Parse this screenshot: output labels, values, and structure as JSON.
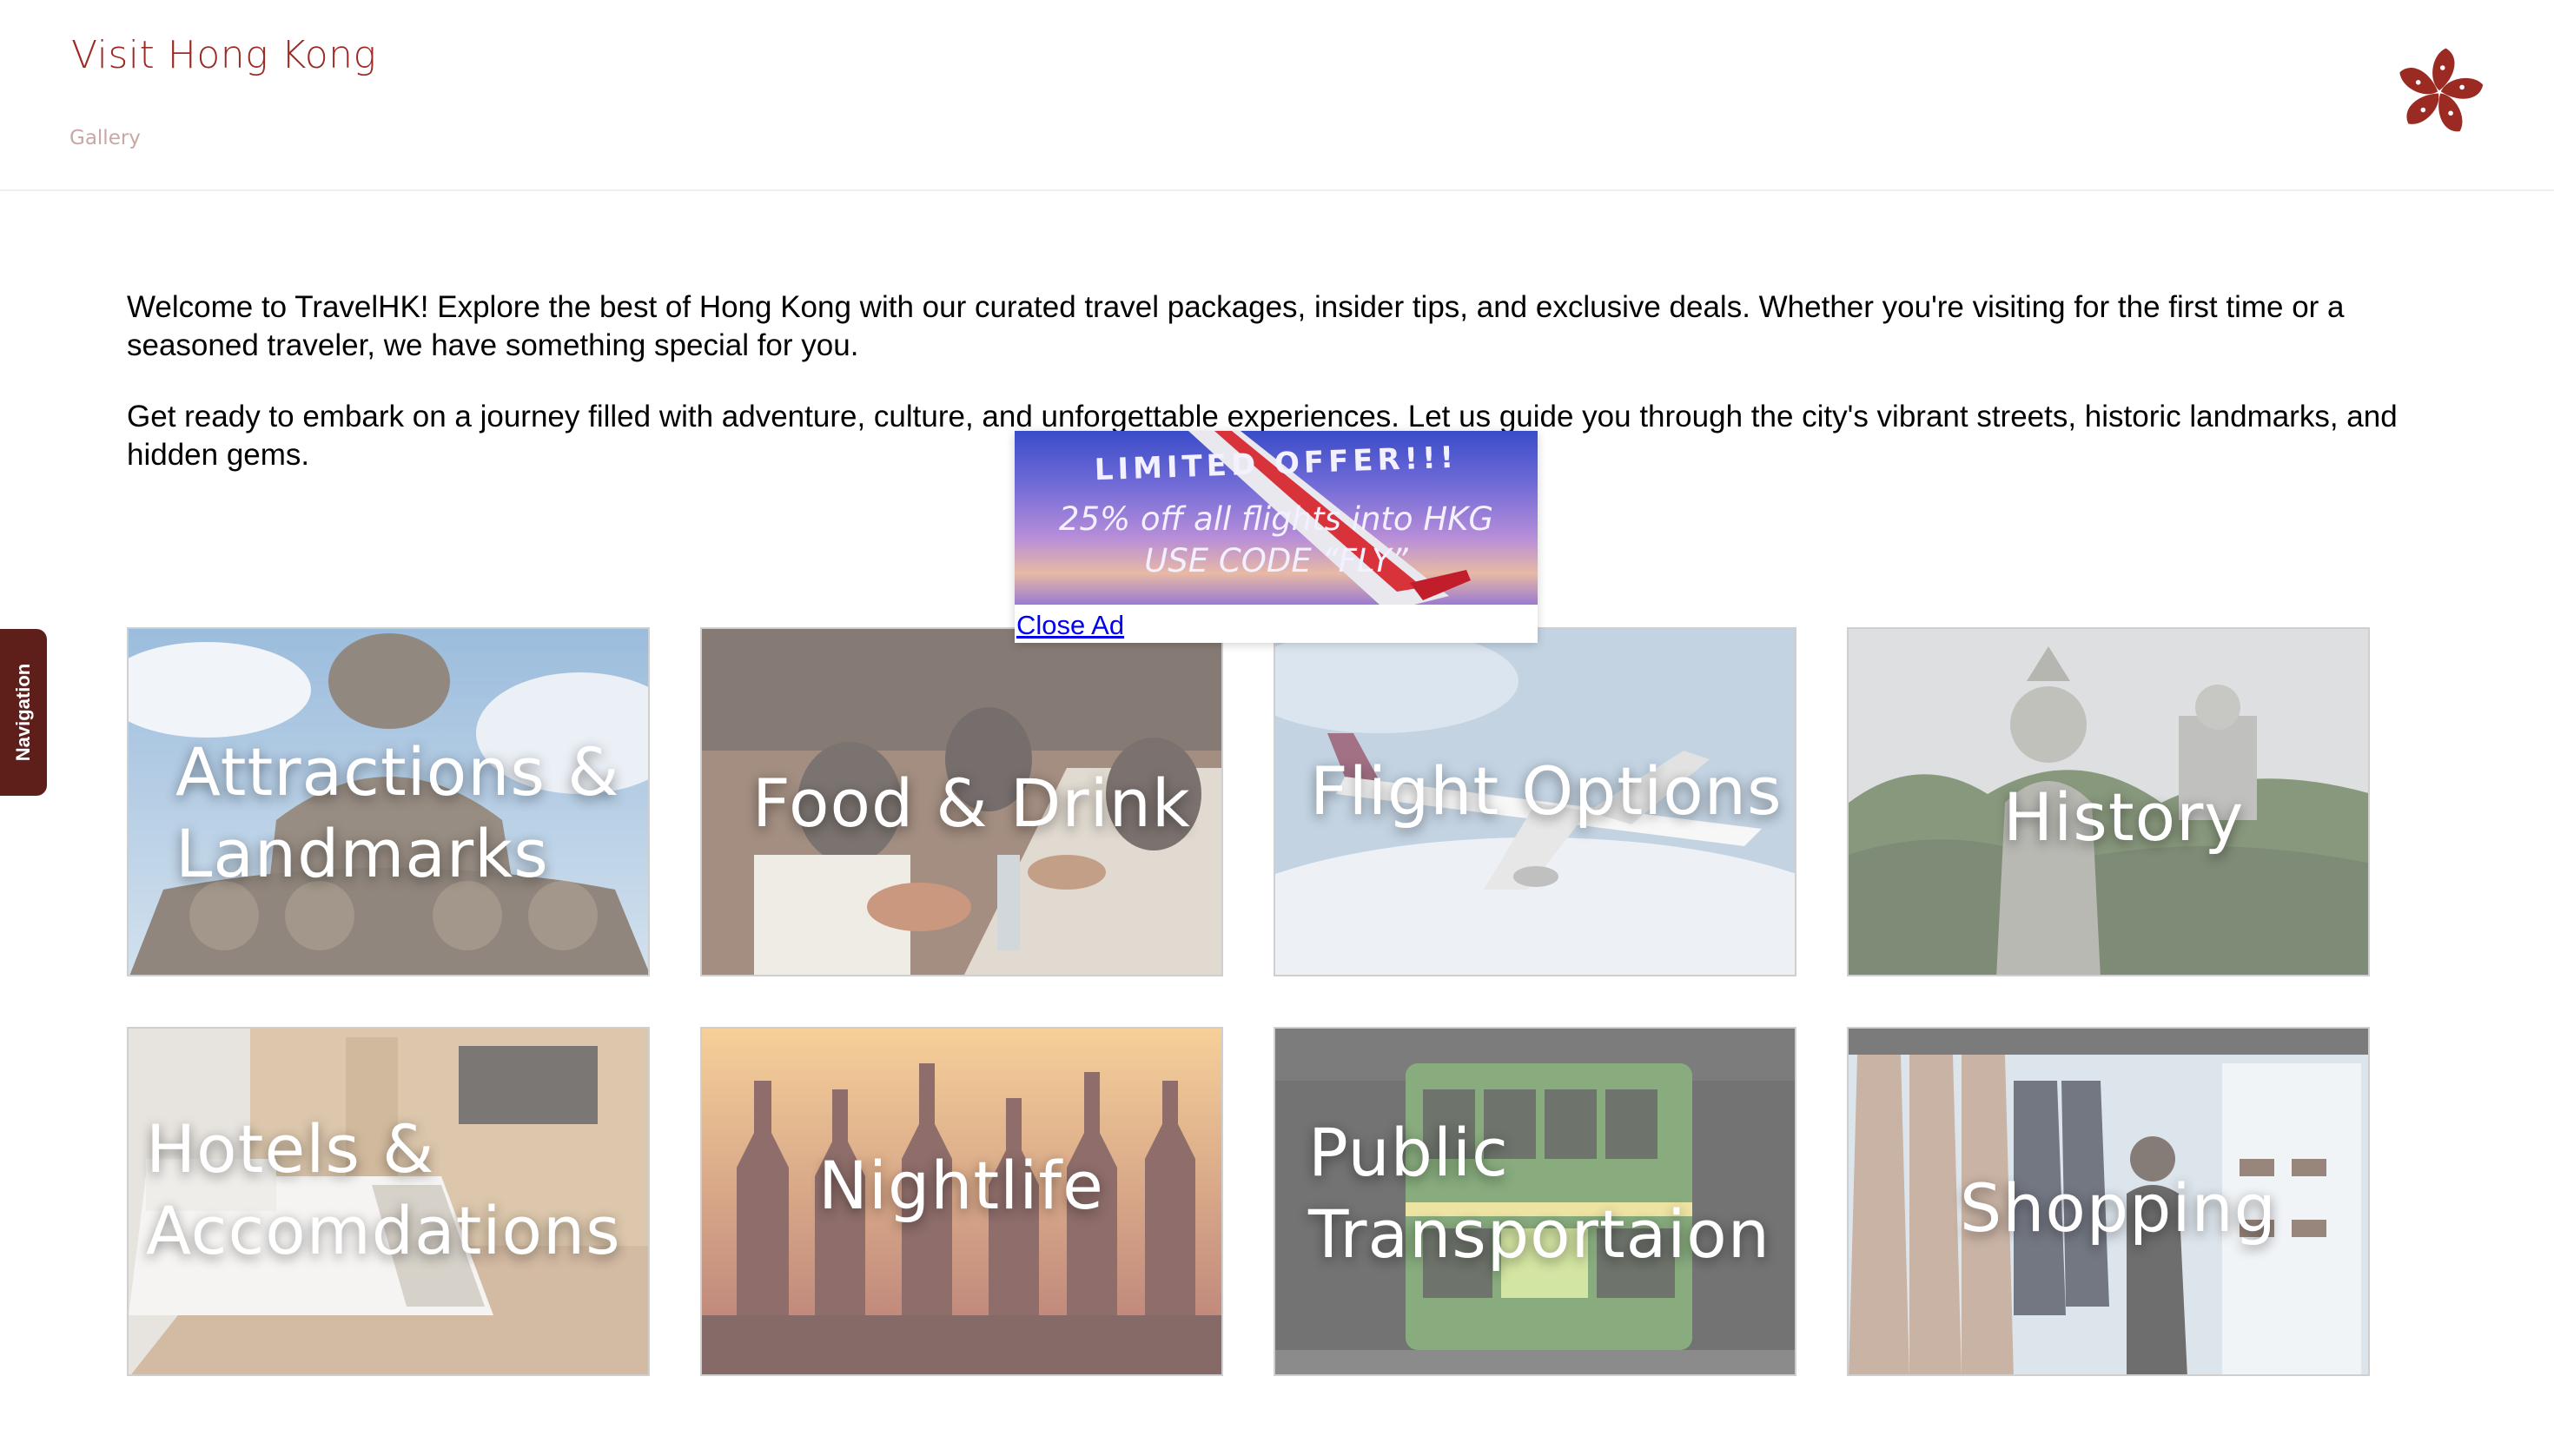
{
  "header": {
    "title": "Visit Hong Kong",
    "nav": [
      "Gallery"
    ],
    "logo_icon": "bauhinia-flower-icon"
  },
  "intro": {
    "paragraph1": "Welcome to TravelHK! Explore the best of Hong Kong with our curated travel packages, insider tips, and exclusive deals. Whether you're visiting for the first time or a seasoned traveler, we have something special for you.",
    "paragraph2": "Get ready to embark on a journey filled with adventure, culture, and unforgettable experiences. Let us guide you through the city's vibrant streets, historic landmarks, and hidden gems."
  },
  "side_tab": {
    "label": "Navigation"
  },
  "ad": {
    "headline": "LIMITED OFFER!!!",
    "line1": "25% off all flights into HKG",
    "line2": "USE CODE “FLY”",
    "close_label": "Close Ad"
  },
  "categories": [
    {
      "label_lines": [
        "Attractions &",
        "Landmarks"
      ],
      "image": "big-buddha-statue"
    },
    {
      "label_lines": [
        "Food & Drink"
      ],
      "image": "diners-eating-noodles"
    },
    {
      "label_lines": [
        "Flight Options"
      ],
      "image": "airplane-in-clouds"
    },
    {
      "label_lines": [
        "History"
      ],
      "image": "guardian-statue-forest"
    },
    {
      "label_lines": [
        "Hotels &",
        "Accomdations"
      ],
      "image": "hotel-bedroom"
    },
    {
      "label_lines": [
        "Nightlife"
      ],
      "image": "bar-bottles"
    },
    {
      "label_lines": [
        "Public",
        "Transportaion"
      ],
      "image": "green-double-decker-tram"
    },
    {
      "label_lines": [
        "Shopping"
      ],
      "image": "clothing-boutique"
    }
  ],
  "colors": {
    "brand": "#9b2a23",
    "side_tab": "#5e1f1b",
    "link": "#0000ee"
  }
}
